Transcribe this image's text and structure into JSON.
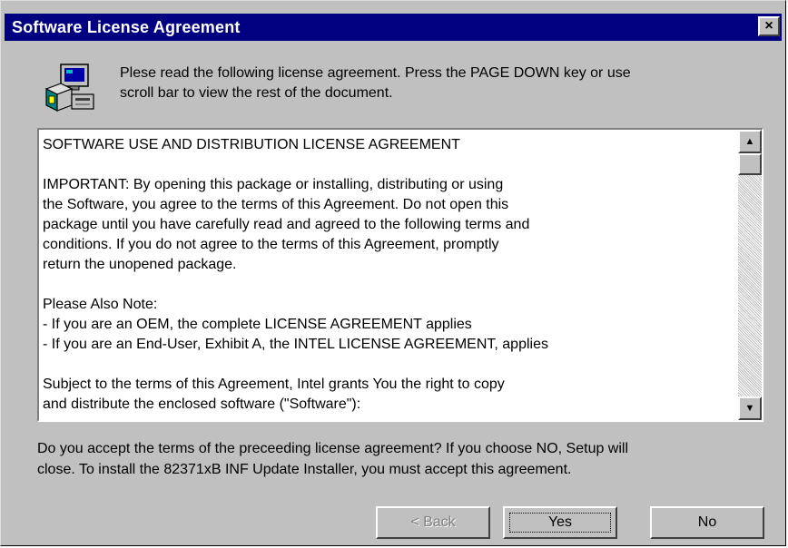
{
  "window": {
    "title": "Software License Agreement",
    "close_label": "×"
  },
  "intro": {
    "line1": "Plese read the following license agreement.  Press the PAGE DOWN key or use",
    "line2": "scroll bar to view the rest of the document."
  },
  "license": {
    "heading": "SOFTWARE USE AND DISTRIBUTION LICENSE AGREEMENT",
    "important": [
      "IMPORTANT:  By opening this package or installing, distributing or using",
      "the Software, you agree to the terms of this Agreement.  Do not open this",
      "package until you have carefully read and agreed to the following terms and",
      "conditions.  If you do not agree to the terms of this Agreement, promptly",
      "return the unopened package."
    ],
    "note_heading": "Please Also Note:",
    "notes": [
      "- If you are an OEM, the complete LICENSE AGREEMENT applies",
      "- If you are an End-User, Exhibit A, the INTEL LICENSE AGREEMENT, applies"
    ],
    "subject": [
      "Subject to the terms of this Agreement, Intel grants You the right to copy",
      "and distribute the enclosed software (\"Software\"):"
    ]
  },
  "scrollbar": {
    "up_glyph": "▲",
    "down_glyph": "▼"
  },
  "question": {
    "line1": "Do you accept the terms of the preceeding license agreement?  If you choose NO, Setup will",
    "line2": "close.  To install the 82371xB INF Update Installer, you must accept this agreement."
  },
  "buttons": {
    "back": "< Back",
    "yes": "Yes",
    "no": "No"
  },
  "icon": "setup-computer-icon",
  "colors": {
    "titlebar": "#000080",
    "dialog_face": "#c0c0c0",
    "disabled_text": "#808080"
  }
}
